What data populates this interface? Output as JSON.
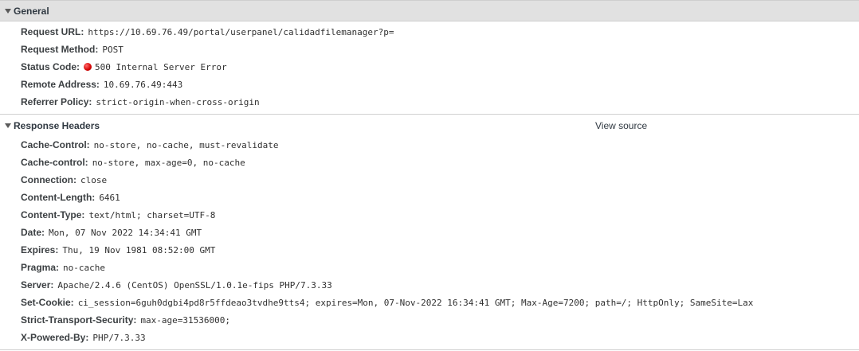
{
  "general": {
    "title": "General",
    "rows": [
      {
        "key": "Request URL:",
        "value": "https://10.69.76.49/portal/userpanel/calidadfilemanager?p="
      },
      {
        "key": "Request Method:",
        "value": "POST"
      },
      {
        "key": "Status Code:",
        "value": "500 Internal Server Error",
        "status_color": "#d30000"
      },
      {
        "key": "Remote Address:",
        "value": "10.69.76.49:443"
      },
      {
        "key": "Referrer Policy:",
        "value": "strict-origin-when-cross-origin"
      }
    ]
  },
  "response_headers": {
    "title": "Response Headers",
    "view_source_label": "View source",
    "rows": [
      {
        "key": "Cache-Control:",
        "value": "no-store, no-cache, must-revalidate"
      },
      {
        "key": "Cache-control:",
        "value": "no-store, max-age=0, no-cache"
      },
      {
        "key": "Connection:",
        "value": "close"
      },
      {
        "key": "Content-Length:",
        "value": "6461"
      },
      {
        "key": "Content-Type:",
        "value": "text/html; charset=UTF-8"
      },
      {
        "key": "Date:",
        "value": "Mon, 07 Nov 2022 14:34:41 GMT"
      },
      {
        "key": "Expires:",
        "value": "Thu, 19 Nov 1981 08:52:00 GMT"
      },
      {
        "key": "Pragma:",
        "value": "no-cache"
      },
      {
        "key": "Server:",
        "value": "Apache/2.4.6 (CentOS) OpenSSL/1.0.1e-fips PHP/7.3.33"
      },
      {
        "key": "Set-Cookie:",
        "value": "ci_session=6guh0dgbi4pd8r5ffdeao3tvdhe9tts4; expires=Mon, 07-Nov-2022 16:34:41 GMT; Max-Age=7200; path=/; HttpOnly; SameSite=Lax"
      },
      {
        "key": "Strict-Transport-Security:",
        "value": "max-age=31536000;"
      },
      {
        "key": "X-Powered-By:",
        "value": "PHP/7.3.33"
      }
    ]
  }
}
